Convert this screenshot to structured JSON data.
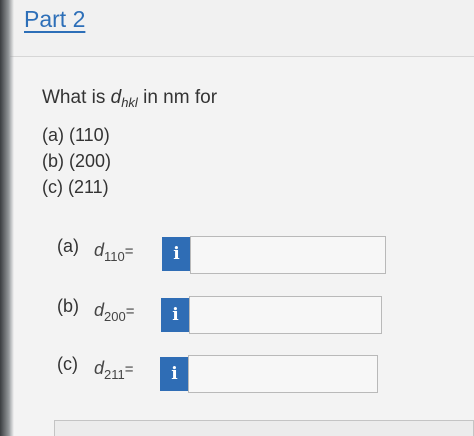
{
  "part": {
    "title": "Part 2"
  },
  "question": {
    "prefix": "What is ",
    "symbol": "d",
    "subscript": "hkl",
    "suffix": " in nm for"
  },
  "items": [
    "(a) (110)",
    "(b) (200)",
    "(c) (211)"
  ],
  "rows": [
    {
      "label": "(a)",
      "symbol": "d",
      "subscript": "110",
      "eq": "=",
      "info": "i",
      "value": ""
    },
    {
      "label": "(b)",
      "symbol": "d",
      "subscript": "200",
      "eq": "=",
      "info": "i",
      "value": ""
    },
    {
      "label": "(c)",
      "symbol": "d",
      "subscript": "211",
      "eq": "=",
      "info": "i",
      "value": ""
    }
  ]
}
